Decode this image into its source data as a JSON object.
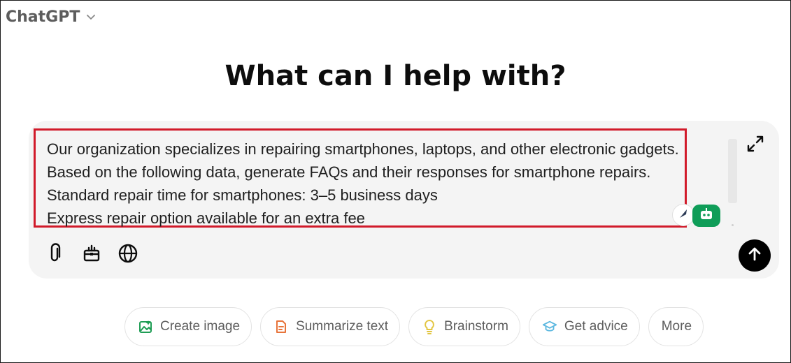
{
  "header": {
    "model_name": "ChatGPT",
    "chevron_icon": "chevron-down-icon"
  },
  "main": {
    "heading": "What can I help with?"
  },
  "composer": {
    "prompt_lines": [
      "Our organization specializes in repairing smartphones, laptops, and other electronic gadgets.",
      "Based on the following data, generate FAQs and their responses for smartphone repairs.",
      "Standard repair time for smartphones: 3–5 business days",
      "Express repair option available for an extra fee"
    ],
    "highlight_color": "#d11a2a",
    "tools": [
      {
        "name": "attach",
        "icon": "paperclip-icon"
      },
      {
        "name": "tools",
        "icon": "toolbox-icon"
      },
      {
        "name": "search-web",
        "icon": "globe-icon"
      }
    ],
    "expand_icon": "expand-icon",
    "send_icon": "arrow-up-icon"
  },
  "suggestions": [
    {
      "label": "Create image",
      "icon": "image-icon",
      "color": "#1f9d55"
    },
    {
      "label": "Summarize text",
      "icon": "document-icon",
      "color": "#e8743b"
    },
    {
      "label": "Brainstorm",
      "icon": "lightbulb-icon",
      "color": "#e2c541"
    },
    {
      "label": "Get advice",
      "icon": "graduation-cap-icon",
      "color": "#5db8e0"
    },
    {
      "label": "More",
      "icon": "",
      "color": ""
    }
  ]
}
